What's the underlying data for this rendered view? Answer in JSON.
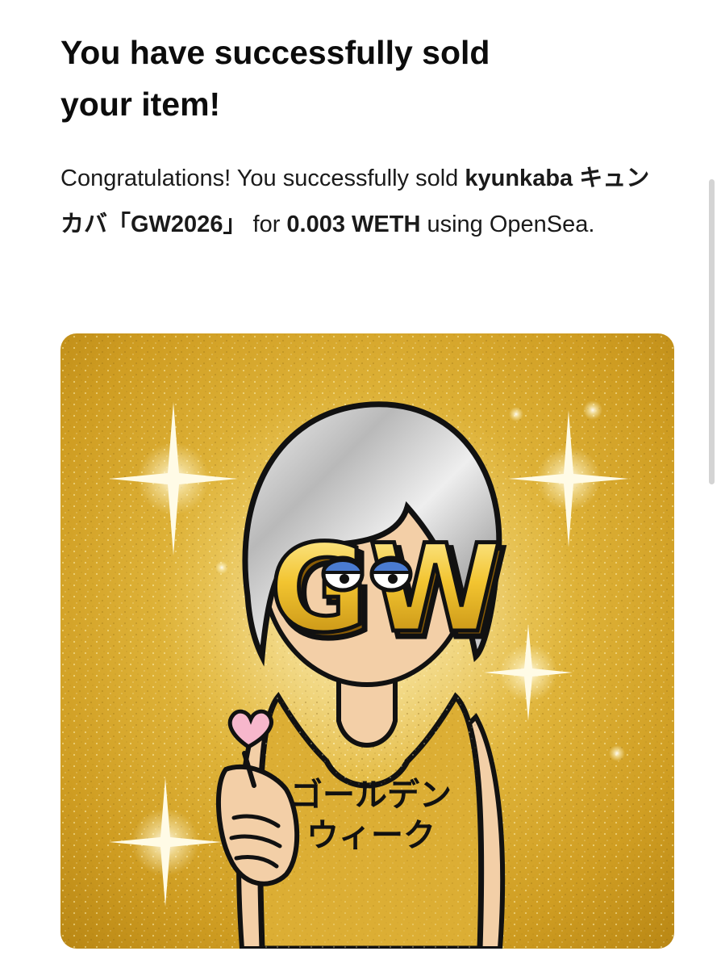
{
  "email": {
    "title_line1": "You have successfully sold",
    "title_line2": "your item!",
    "intro": "Congratulations! You successfully sold",
    "item_name": "kyunkaba キュンカバ「GW2026」",
    "price_prefix": "for",
    "price": "0.003 WETH",
    "marketplace_text": "using OpenSea."
  },
  "nft_image": {
    "face_letters": "GW",
    "shirt_line1": "ゴールデン",
    "shirt_line2": "ウィーク",
    "icons": [
      "heart-icon",
      "sparkle-icon"
    ]
  },
  "colors": {
    "gold": "#d7a92a",
    "gold_light": "#f4d77a",
    "hair_silver": "#c9c9c9",
    "skin": "#f3cfa7",
    "heart_pink": "#f7b7cc",
    "outline": "#111111"
  }
}
